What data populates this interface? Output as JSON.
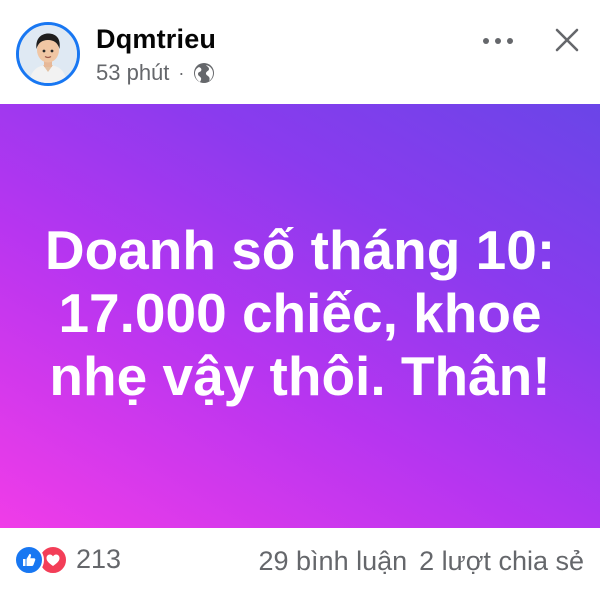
{
  "post": {
    "author": "Dqmtrieu",
    "time": "53 phút",
    "separator": "·",
    "audience_icon": "globe-icon",
    "avatar_icon": "cartoon-avatar",
    "accent_color": "#1877f2"
  },
  "content": {
    "text": "Doanh số tháng 10: 17.000 chiếc, khoe nhẹ vậy thôi. Thân!",
    "background_colors": [
      "#f03ce8",
      "#b735f0",
      "#8a3bee",
      "#6a45e8"
    ]
  },
  "footer": {
    "reaction_icons": [
      "like-icon",
      "love-icon"
    ],
    "reaction_count": "213",
    "comments": "29 bình luận",
    "shares": "2 lượt chia sẻ"
  },
  "actions": {
    "more_icon": "more-icon",
    "close_icon": "close-icon"
  }
}
